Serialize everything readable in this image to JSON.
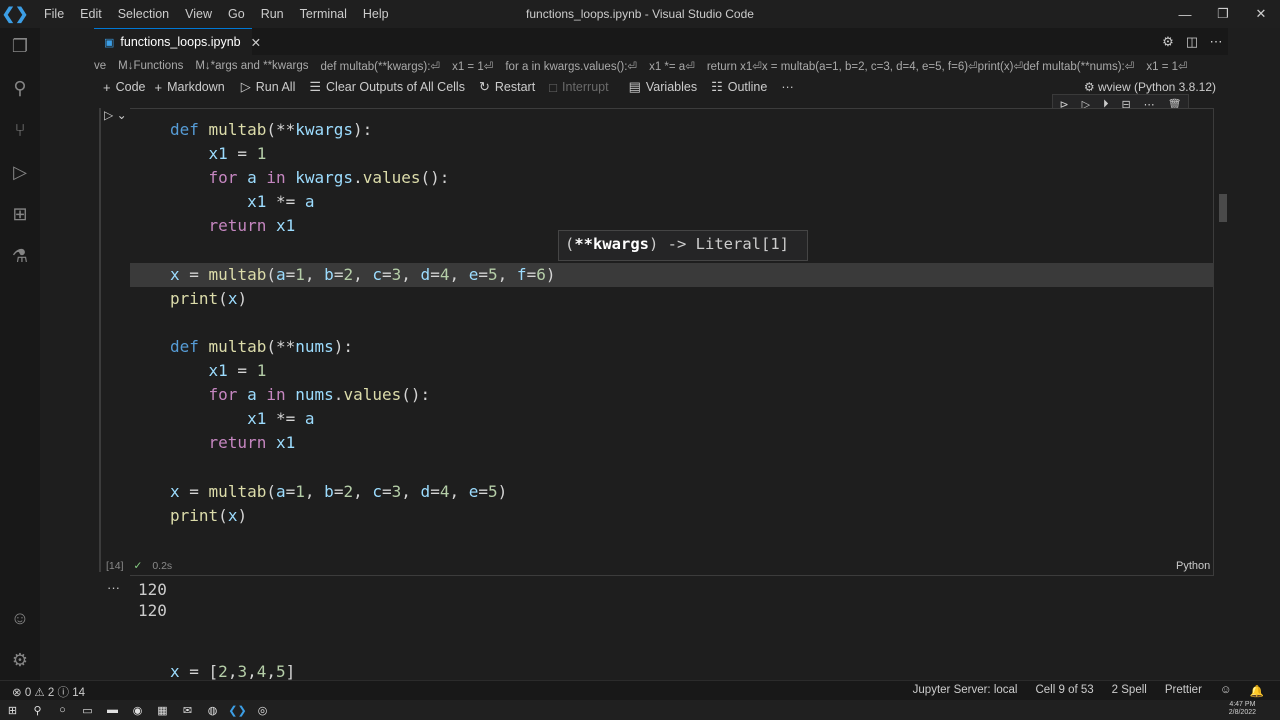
{
  "titlebar": {
    "menu": [
      "File",
      "Edit",
      "Selection",
      "View",
      "Go",
      "Run",
      "Terminal",
      "Help"
    ],
    "title": "functions_loops.ipynb - Visual Studio Code",
    "controls": [
      "—",
      "❐",
      "✕"
    ]
  },
  "tab": {
    "label": "functions_loops.ipynb",
    "close": "✕"
  },
  "breadcrumbs": [
    "ve",
    "M↓Functions",
    "M↓*args and **kwargs",
    "def multab(**kwargs):⏎",
    "x1 = 1⏎",
    "for a in kwargs.values():⏎",
    "x1 *= a⏎",
    "return x1⏎x = multab(a=1, b=2, c=3, d=4, e=5, f=6)⏎print(x)⏎def multab(**nums):⏎",
    "x1 = 1⏎"
  ],
  "toolbar": {
    "code": "Code",
    "markdown": "Markdown",
    "run_all": "Run All",
    "clear": "Clear Outputs of All Cells",
    "restart": "Restart",
    "interrupt": "Interrupt",
    "variables": "Variables",
    "outline": "Outline",
    "more": "···",
    "kernel": "wview (Python 3.8.12)"
  },
  "hover": {
    "bold": "**kwargs",
    "text": ") -> Literal[1]",
    "open": "("
  },
  "cell": {
    "count": "[14]",
    "time": "0.2s",
    "lang": "Python"
  },
  "output": [
    "120",
    "120"
  ],
  "next_cell": "x = [2,3,4,5]",
  "status": {
    "left": "⊗ 0 ⚠ 2 ⓘ 14",
    "jupyter": "Jupyter Server: local",
    "cell": "Cell 9 of 53",
    "spell": "2 Spell",
    "prettier": "Prettier"
  },
  "clock": {
    "time": "4:47 PM",
    "date": "2/8/2022"
  }
}
